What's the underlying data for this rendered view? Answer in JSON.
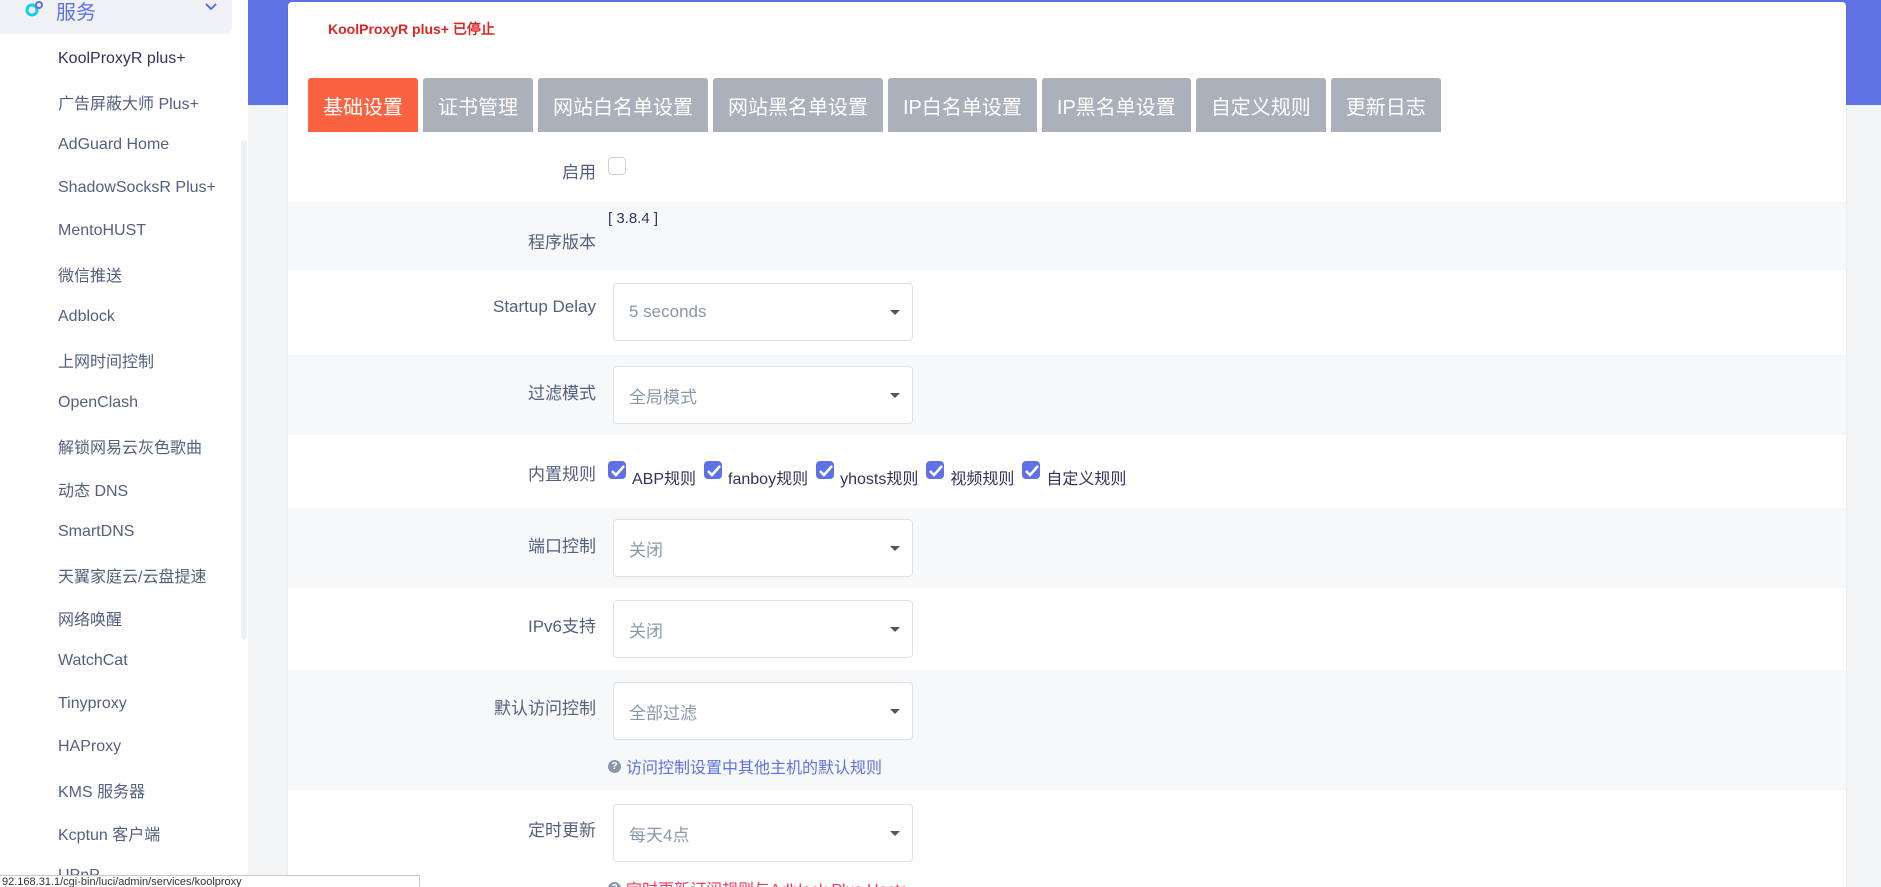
{
  "sidebar": {
    "section_label": "服务",
    "items": [
      "KoolProxyR plus+",
      "广告屏蔽大师 Plus+",
      "AdGuard Home",
      "ShadowSocksR Plus+",
      "MentoHUST",
      "微信推送",
      "Adblock",
      "上网时间控制",
      "OpenClash",
      "解锁网易云灰色歌曲",
      "动态 DNS",
      "SmartDNS",
      "天翼家庭云/云盘提速",
      "网络唤醒",
      "WatchCat",
      "Tinyproxy",
      "HAProxy",
      "KMS 服务器",
      "Kcptun 客户端",
      "UPnP"
    ]
  },
  "statusbar": {
    "text": "92.168.31.1/cgi-bin/luci/admin/services/koolproxy"
  },
  "card": {
    "title": "KoolProxyR plus+ 已停止"
  },
  "tabs": [
    "基础设置",
    "证书管理",
    "网站白名单设置",
    "网站黑名单设置",
    "IP白名单设置",
    "IP黑名单设置",
    "自定义规则",
    "更新日志"
  ],
  "form": {
    "enable_label": "启用",
    "version_label": "程序版本",
    "version_value": "[ 3.8.4 ]",
    "startup_label": "Startup Delay",
    "startup_value": "5 seconds",
    "filter_label": "过滤模式",
    "filter_value": "全局模式",
    "builtin_label": "内置规则",
    "builtin_rules": [
      "ABP规则",
      "fanboy规则",
      "yhosts规则",
      "视频规则",
      "自定义规则"
    ],
    "port_label": "端口控制",
    "port_value": "关闭",
    "ipv6_label": "IPv6支持",
    "ipv6_value": "关闭",
    "access_label": "默认访问控制",
    "access_value": "全部过滤",
    "access_help": "访问控制设置中其他主机的默认规则",
    "update_label": "定时更新",
    "update_value": "每天4点",
    "update_help": "定时更新订阅规则与Adblock Plus Hosts"
  },
  "colors": {
    "accent": "#5e72e4",
    "active_tab": "#fb6340",
    "inactive_tab": "#aab1ba",
    "status_stopped": "#dc2626",
    "help_red": "#f5365c"
  }
}
